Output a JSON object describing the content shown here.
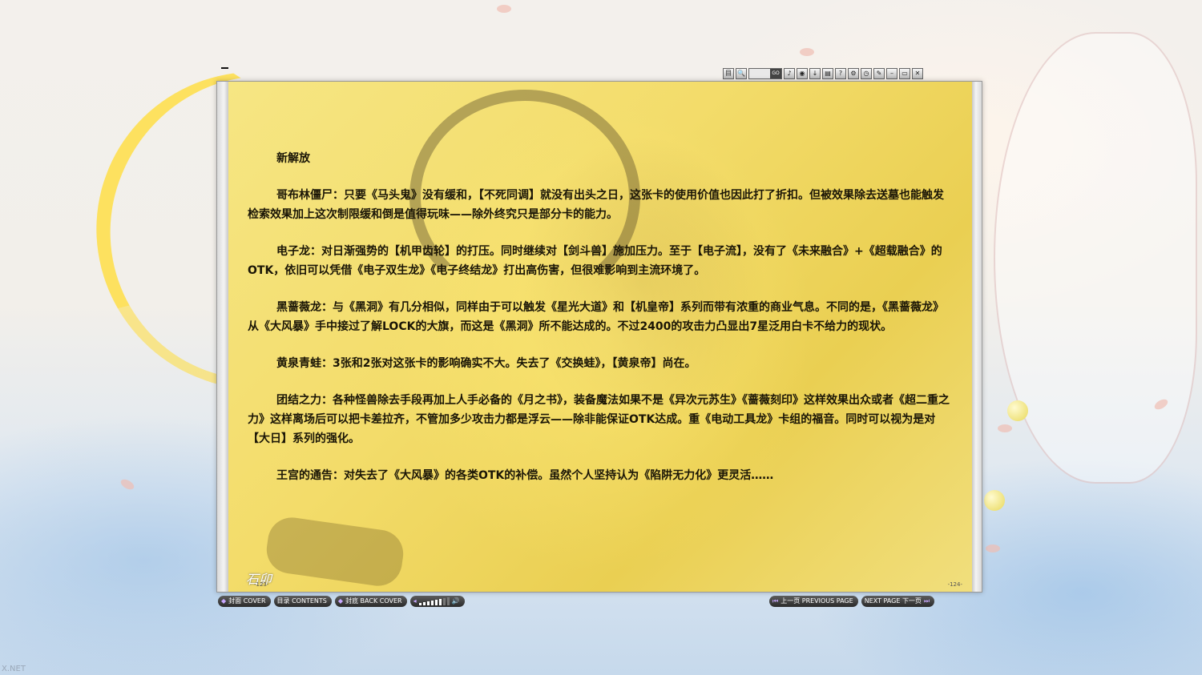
{
  "toolbar": {
    "buttons": [
      {
        "name": "toc-icon",
        "glyph": "目"
      },
      {
        "name": "zoom-icon",
        "glyph": "🔍"
      },
      {
        "name": "go-label",
        "glyph": "GO"
      },
      {
        "name": "sound-icon",
        "glyph": "♪"
      },
      {
        "name": "user-icon",
        "glyph": "◉"
      },
      {
        "name": "download-icon",
        "glyph": "↓"
      },
      {
        "name": "print-icon",
        "glyph": "▤"
      },
      {
        "name": "help-icon",
        "glyph": "?"
      },
      {
        "name": "settings-icon",
        "glyph": "⚙"
      },
      {
        "name": "clock-icon",
        "glyph": "◷"
      },
      {
        "name": "pen-icon",
        "glyph": "✎"
      },
      {
        "name": "minimize-icon",
        "glyph": "–"
      },
      {
        "name": "maximize-icon",
        "glyph": "▭"
      },
      {
        "name": "close-icon",
        "glyph": "✕"
      }
    ],
    "page_go": "GO"
  },
  "book": {
    "title": "新解放",
    "paragraphs": [
      "哥布林僵尸：只要《马头鬼》没有缓和，【不死同调】就没有出头之日，这张卡的使用价值也因此打了折扣。但被效果除去送墓也能触发检索效果加上这次制限缓和倒是值得玩味——除外终究只是部分卡的能力。",
      "电子龙：对日渐强势的【机甲齿轮】的打压。同时继续对【剑斗兽】施加压力。至于【电子流】，没有了《未来融合》+《超载融合》的OTK，依旧可以凭借《电子双生龙》《电子终结龙》打出高伤害，但很难影响到主流环境了。",
      "黑蔷薇龙：与《黑洞》有几分相似，同样由于可以触发《星光大道》和【机皇帝】系列而带有浓重的商业气息。不同的是，《黑蔷薇龙》从《大风暴》手中接过了解LOCK的大旗，而这是《黑洞》所不能达成的。不过2400的攻击力凸显出7星泛用白卡不给力的现状。",
      "黄泉青蛙：3张和2张对这张卡的影响确实不大。失去了《交换蛙》，【黄泉帝】尚在。",
      "团结之力：各种怪兽除去手段再加上人手必备的《月之书》，装备魔法如果不是《异次元苏生》《蔷薇刻印》这样效果出众或者《超二重之力》这样离场后可以把卡差拉齐，不管加多少攻击力都是浮云——除非能保证OTK达成。重《电动工具龙》卡组的福音。同时可以视为是对【大日】系列的强化。",
      "王宫的通告：对失去了《大风暴》的各类OTK的补偿。虽然个人坚持认为《陷阱无力化》更灵活……"
    ],
    "page_left": "-123-",
    "page_right": "-124-",
    "signature": "石卯"
  },
  "nav": {
    "cover": "封面 COVER",
    "contents": "目录 CONTENTS",
    "back_cover": "封底 BACK COVER",
    "prev": "上一页 PREVIOUS PAGE",
    "next": "NEXT PAGE 下一页",
    "volume_level": 0.8
  },
  "watermark": "X.NET",
  "colors": {
    "page_bg": "#f3dc6a",
    "text": "#1a1506",
    "nav_bg": "#2a2a2a",
    "accent": "#c8a8ff"
  }
}
